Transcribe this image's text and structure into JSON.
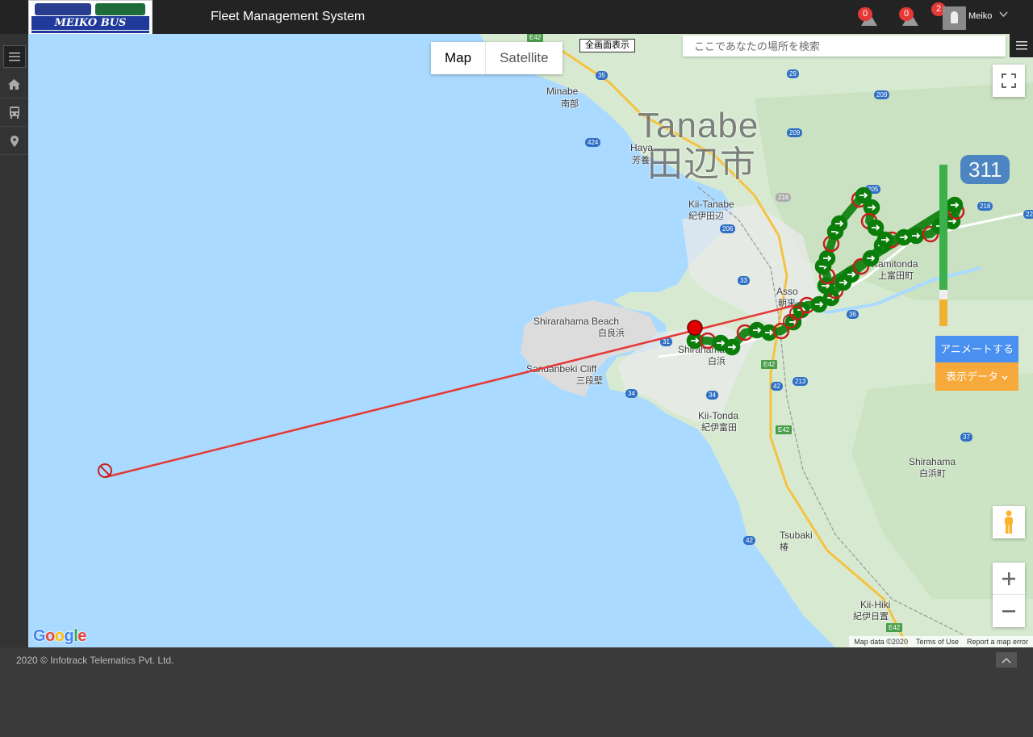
{
  "header": {
    "logo_text": "MEIKO BUS",
    "app_title": "Fleet Management System",
    "alerts": [
      {
        "count": "0",
        "icon": "warning-icon"
      },
      {
        "count": "0",
        "icon": "warning-icon"
      }
    ],
    "user": {
      "notifications": "2",
      "name": "Meiko"
    }
  },
  "sidebar": {
    "items": [
      {
        "icon": "menu-icon"
      },
      {
        "icon": "home-icon"
      },
      {
        "icon": "bus-icon"
      },
      {
        "icon": "map-marker-icon"
      }
    ]
  },
  "map": {
    "type_control": {
      "map_label": "Map",
      "satellite_label": "Satellite",
      "selected": "Map"
    },
    "fullscreen_label": "全画面表示",
    "search_placeholder": "ここであなたの場所を検索",
    "buttons": {
      "animate": "アニメートする",
      "display_data": "表示データ"
    },
    "places": {
      "tanabe_en": "Tanabe",
      "tanabe_jp": "田辺市",
      "minabe_en": "Minabe",
      "minabe_jp": "南部",
      "haya_en": "Haya",
      "haya_jp": "芳養",
      "kii_tanabe_en": "Kii-Tanabe",
      "kii_tanabe_jp": "紀伊田辺",
      "kamitonda_en": "Kamitonda",
      "kamitonda_jp": "上富田町",
      "asso_en": "Asso",
      "asso_jp": "朝来",
      "shirarahama_en": "Shirarahama Beach",
      "shirarahama_jp": "白良浜",
      "shirahama_en": "Shirahama",
      "shirahama_jp": "白浜",
      "sandanbeki_en": "Sandanbeki Cliff",
      "sandanbeki_jp": "三段壁",
      "kii_tonda_en": "Kii-Tonda",
      "kii_tonda_jp": "紀伊富田",
      "shirahama_town_en": "Shirahama",
      "shirahama_town_jp": "白浜町",
      "tsubaki_en": "Tsubaki",
      "tsubaki_jp": "椿",
      "kii_hiki_en": "Kii-Hiki",
      "kii_hiki_jp": "紀伊日置"
    },
    "roads": [
      "E42",
      "35",
      "424",
      "29",
      "209",
      "209",
      "311",
      "216",
      "218",
      "22",
      "205",
      "206",
      "33",
      "36",
      "31",
      "E42",
      "42",
      "213",
      "34",
      "34",
      "E42",
      "37",
      "42",
      "E42"
    ],
    "google_logo": "Google",
    "attribution": {
      "map_data": "Map data ©2020",
      "terms": "Terms of Use",
      "report": "Report a map error"
    }
  },
  "footer": {
    "copyright": "2020 © Infotrack Telematics Pvt. Ltd."
  },
  "colors": {
    "track_green": "#0a7d0a",
    "track_red": "#c81e1e",
    "animate": "#4a90f0",
    "display_data": "#f7a93b"
  }
}
